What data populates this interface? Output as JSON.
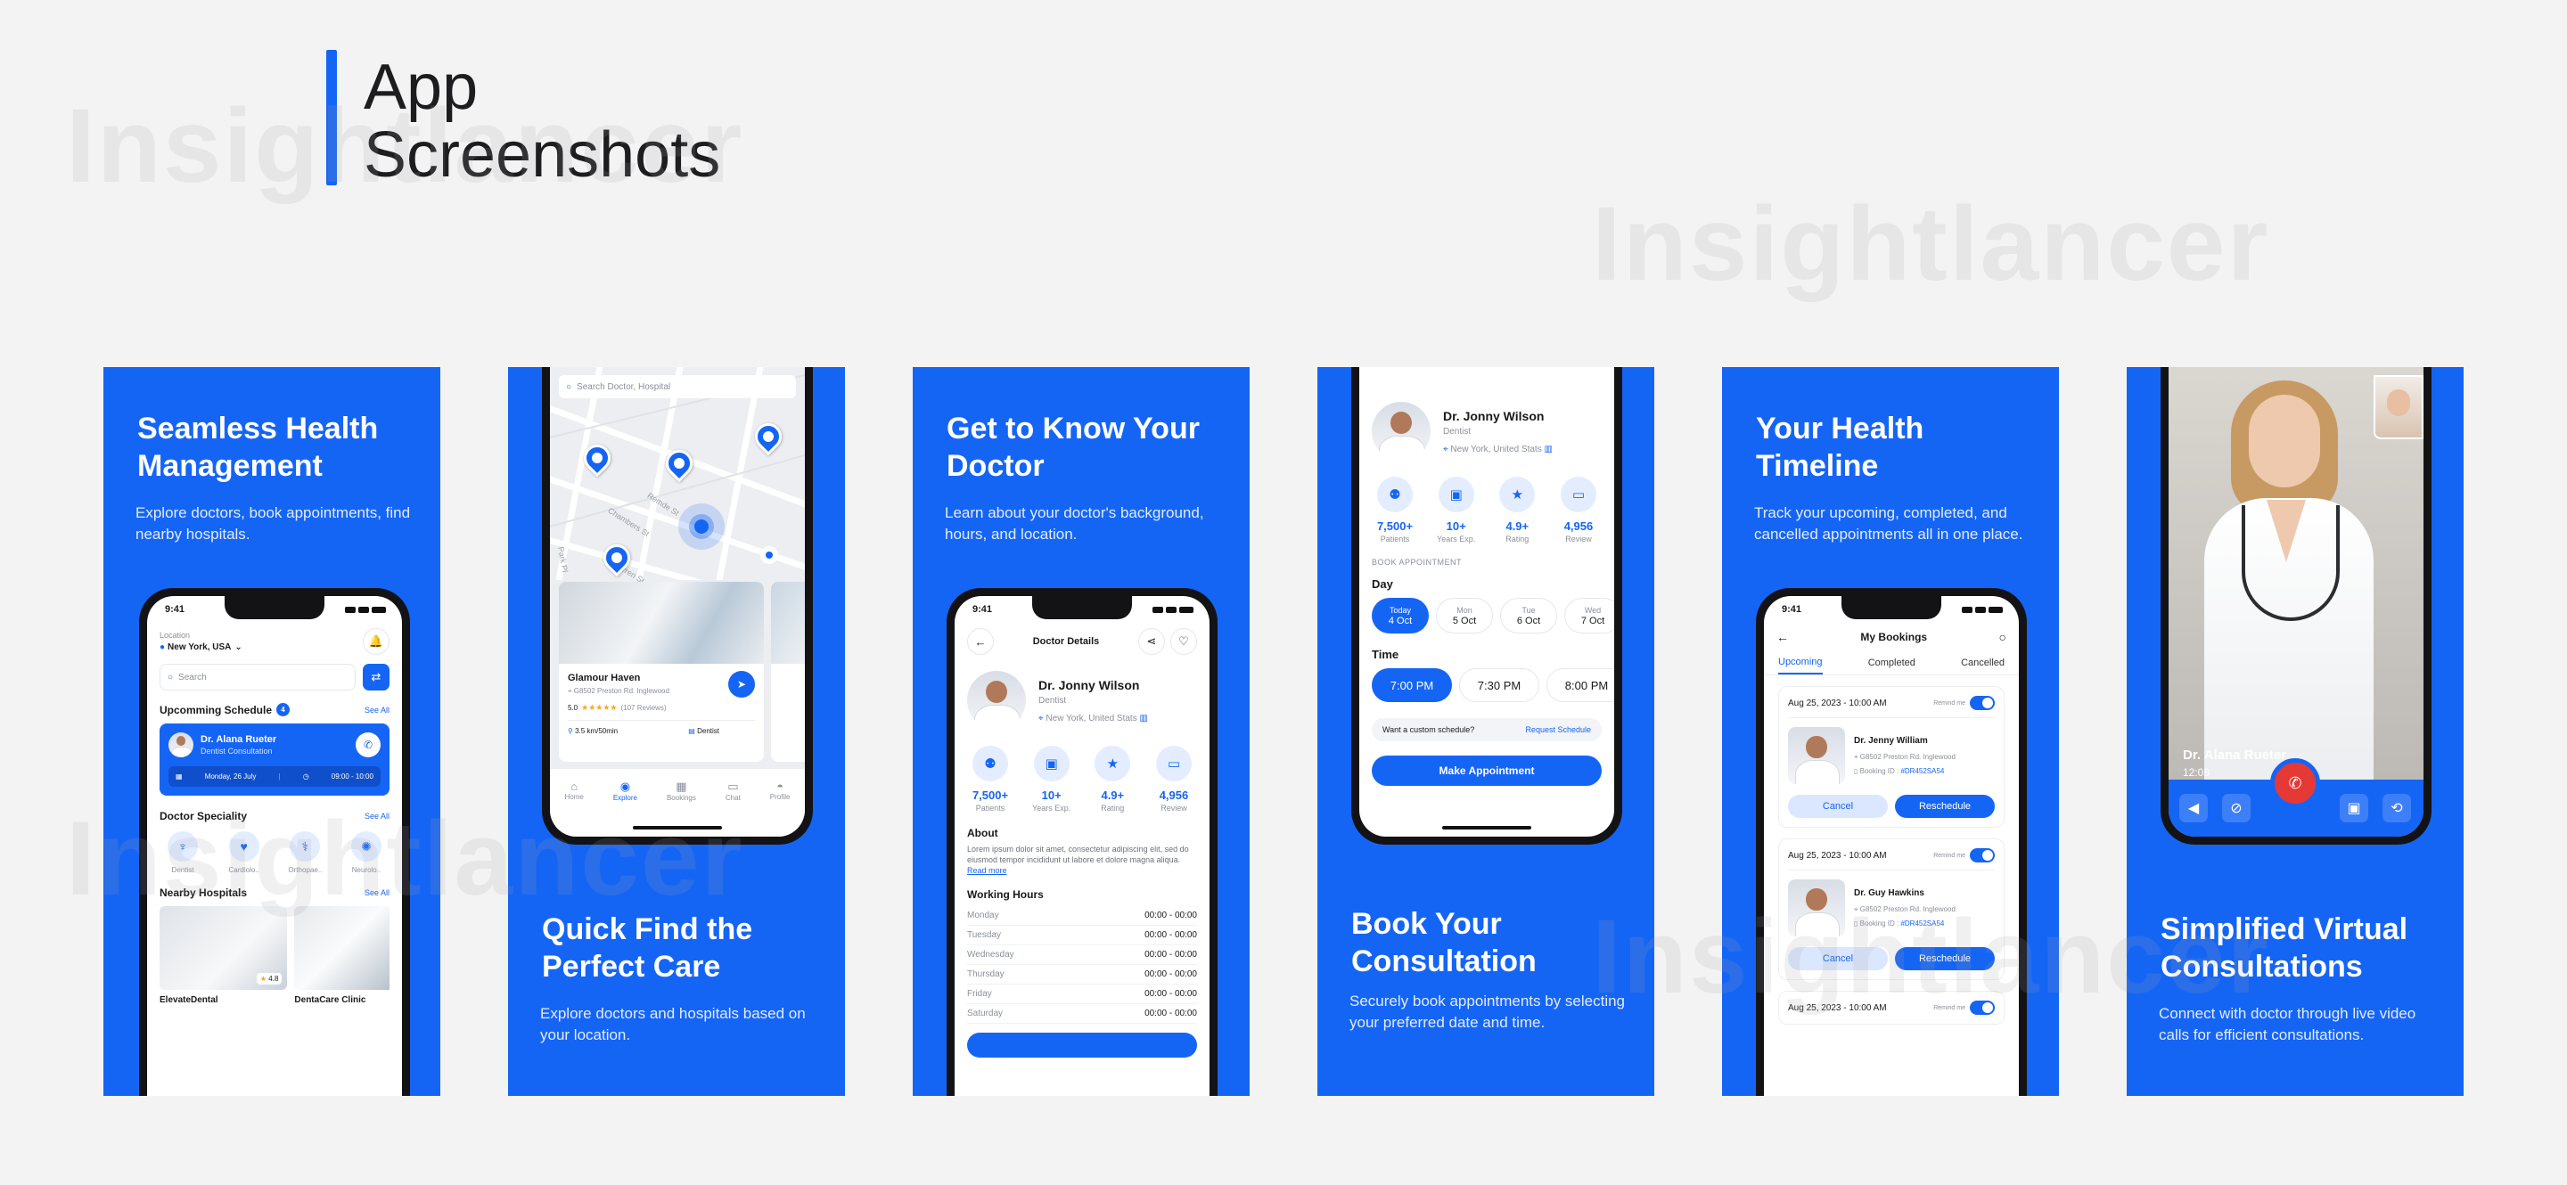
{
  "heading": {
    "line1": "App",
    "line2": "Screenshots"
  },
  "watermark": "Insightlancer",
  "colors": {
    "accent": "#1565f5",
    "background": "#f3f3f4",
    "end_call": "#e53935"
  },
  "panels": [
    {
      "title": "Seamless Health Management",
      "desc": "Explore doctors, book appointments, find nearby hospitals."
    },
    {
      "title": "Quick Find the Perfect Care",
      "desc": "Explore doctors and hospitals based on your location."
    },
    {
      "title": "Get to Know Your Doctor",
      "desc": "Learn about your doctor's background, hours, and location."
    },
    {
      "title": "Book Your Consultation",
      "desc": "Securely book appointments by selecting your preferred date and time."
    },
    {
      "title": "Your Health Timeline",
      "desc": "Track your upcoming, completed, and cancelled appointments all in one place."
    },
    {
      "title": "Simplified Virtual Consultations",
      "desc": "Connect with doctor through live video calls for efficient consultations."
    }
  ],
  "status_time": "9:41",
  "home": {
    "location_label": "Location",
    "location": "New York, USA",
    "search_placeholder": "Search",
    "schedule_title": "Upcomming Schedule",
    "schedule_count": "4",
    "see_all": "See All",
    "card_doctor": "Dr. Alana Rueter",
    "card_type": "Dentist Consultation",
    "card_date": "Monday, 26 July",
    "card_time": "09:00 - 10:00",
    "speciality_title": "Doctor Speciality",
    "specialities": [
      "Dentist",
      "Cardiolo..",
      "Orthopae..",
      "Neurolo.."
    ],
    "nearby_title": "Nearby Hospitals",
    "hospitals": [
      "ElevateDental",
      "DentaCare Clinic"
    ],
    "rating": "4.8"
  },
  "map": {
    "search_placeholder": "Search Doctor, Hospital",
    "streets": [
      "Remde St",
      "Chambers St",
      "Warren St",
      "Park Pl"
    ],
    "hospital_name": "Glamour Haven",
    "hospital_address": "G8502 Preston Rd. Inglewood",
    "rating": "5.0",
    "reviews": "(107 Reviews)",
    "distance": "3.5 km/50min",
    "category": "Dentist",
    "nav": [
      "Home",
      "Explore",
      "Bookings",
      "Chat",
      "Profile"
    ]
  },
  "doctor": {
    "screen_title": "Doctor Details",
    "name": "Dr. Jonny Wilson",
    "specialty": "Dentist",
    "location": "New York, United Stats",
    "stats": [
      {
        "value": "7,500+",
        "label": "Patients"
      },
      {
        "value": "10+",
        "label": "Years Exp."
      },
      {
        "value": "4.9+",
        "label": "Rating"
      },
      {
        "value": "4,956",
        "label": "Review"
      }
    ],
    "about_title": "About",
    "about_text": "Lorem ipsum dolor sit amet, consectetur adipiscing elit, sed do eiusmod tempor incididunt ut labore et dolore magna aliqua.",
    "read_more": "Read more",
    "hours_title": "Working Hours",
    "hours": [
      {
        "day": "Monday",
        "time": "00:00 - 00:00"
      },
      {
        "day": "Tuesday",
        "time": "00:00 - 00:00"
      },
      {
        "day": "Wednesday",
        "time": "00:00 - 00:00"
      },
      {
        "day": "Thursday",
        "time": "00:00 - 00:00"
      },
      {
        "day": "Friday",
        "time": "00:00 - 00:00"
      },
      {
        "day": "Saturday",
        "time": "00:00 - 00:00"
      }
    ]
  },
  "booking": {
    "section_label": "BOOK APPOINTMENT",
    "day_label": "Day",
    "days": [
      {
        "top": "Today",
        "bottom": "4 Oct"
      },
      {
        "top": "Mon",
        "bottom": "5 Oct"
      },
      {
        "top": "Tue",
        "bottom": "6 Oct"
      },
      {
        "top": "Wed",
        "bottom": "7 Oct"
      }
    ],
    "time_label": "Time",
    "times": [
      "7:00 PM",
      "7:30 PM",
      "8:00 PM"
    ],
    "custom_q": "Want a custom schedule?",
    "request": "Request Schedule",
    "cta": "Make Appointment"
  },
  "bookings": {
    "title": "My Bookings",
    "tabs": [
      "Upcoming",
      "Completed",
      "Cancelled"
    ],
    "remind": "Remind me",
    "cancel": "Cancel",
    "reschedule": "Reschedule",
    "booking_id_label": "Booking ID :",
    "items": [
      {
        "date": "Aug 25, 2023 - 10:00 AM",
        "doctor": "Dr. Jenny William",
        "address": "G8502 Preston Rd. Inglewood",
        "booking_id": "#DR452SA54"
      },
      {
        "date": "Aug 25, 2023 - 10:00 AM",
        "doctor": "Dr. Guy Hawkins",
        "address": "G8502 Preston Rd. Inglewood",
        "booking_id": "#DR452SA54"
      },
      {
        "date": "Aug 25, 2023 - 10:00 AM"
      }
    ]
  },
  "video": {
    "doctor": "Dr. Alana Rueter",
    "timer": "12:08"
  }
}
